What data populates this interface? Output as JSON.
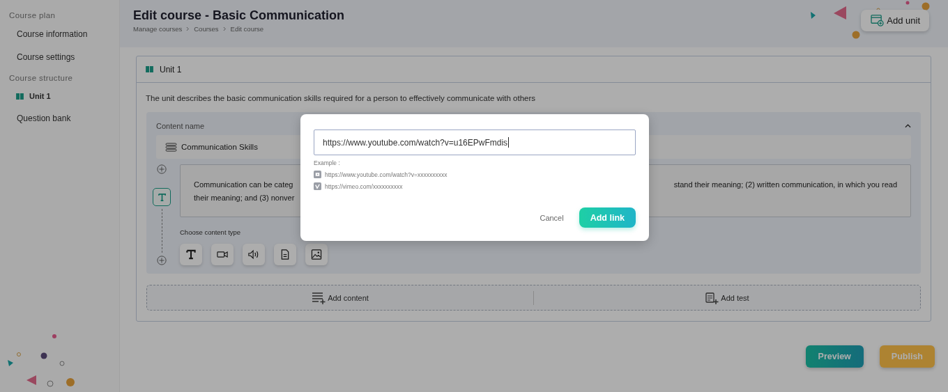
{
  "sidebar": {
    "sections": [
      {
        "title": "Course plan",
        "items": [
          {
            "label": "Course information",
            "kind": "link",
            "selected": false
          },
          {
            "label": "Course settings",
            "kind": "link",
            "selected": false
          }
        ]
      },
      {
        "title": "Course structure",
        "items": [
          {
            "label": "Unit 1",
            "kind": "unit",
            "selected": true
          },
          {
            "label": "Question bank",
            "kind": "link",
            "selected": false
          }
        ]
      }
    ]
  },
  "header": {
    "title": "Edit course - Basic Communication",
    "breadcrumbs": [
      "Manage courses",
      "Courses",
      "Edit course"
    ],
    "add_unit": "Add unit"
  },
  "unit": {
    "title": "Unit 1",
    "description": "The unit describes the basic communication skills required for a person to effectively communicate with others",
    "content": {
      "label": "Content name",
      "expanded": true,
      "name": "Communication Skills",
      "text_lines": [
        {
          "start": "Communication can be categ",
          "end": "stand their meaning; (2) written communication, in which you read"
        },
        {
          "start": "their meaning; and (3) nonver"
        }
      ],
      "type_label": "Choose content type"
    },
    "add_content": "Add content",
    "add_test": "Add test"
  },
  "actions": [
    {
      "label": "Preview",
      "kind": "preview"
    },
    {
      "label": "Publish",
      "kind": "publish"
    }
  ],
  "dialog": {
    "value": "https://www.youtube.com/watch?v=u16EPwFmdis",
    "example_label": "Example :",
    "examples": [
      {
        "kind": "youtube",
        "url": "https://www.youtube.com/watch?v=xxxxxxxxxx"
      },
      {
        "kind": "vimeo",
        "url": "https://vimeo.com/xxxxxxxxxx"
      }
    ],
    "cancel": "Cancel",
    "confirm": "Add link"
  }
}
